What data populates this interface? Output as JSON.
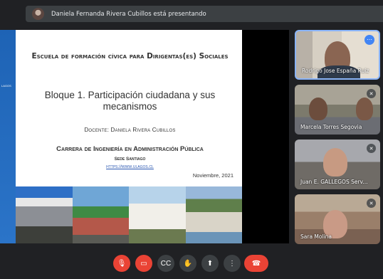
{
  "presenting": {
    "text": "Daniela Fernanda Rivera Cubillos está presentando"
  },
  "slide": {
    "sidebar_text": "LAGOS",
    "title": "Escuela de formación cívica para Dirigentas(es) Sociales",
    "subtitle": "Bloque 1. Participación ciudadana y sus mecanismos",
    "docente": "Docente: Daniela Rivera Cubillos",
    "carrera": "Carrera de Ingeniería en Administración Pública",
    "sede": "Sede Santiago",
    "url": "https://www.ulagos.cl",
    "date": "Noviembre, 2021"
  },
  "participants": [
    {
      "name": "Rodrigo Jose España Ruiz",
      "indicator": "more-icon"
    },
    {
      "name": "Marcela Torres Segovia",
      "indicator": "mic-off-icon"
    },
    {
      "name": "Juan E. GALLEGOS Serv...",
      "indicator": "mic-off-icon"
    },
    {
      "name": "Sara Molina",
      "indicator": "mic-off-icon"
    }
  ],
  "controls": {
    "mic": "mic-off-icon",
    "camera": "camera-off-icon",
    "captions": "captions-icon",
    "raise_hand": "raise-hand-icon",
    "present": "present-screen-icon",
    "more": "more-vert-icon",
    "hangup": "hangup-icon"
  },
  "colors": {
    "background": "#202124",
    "hangup": "#ea4335",
    "accent": "#4285f4"
  }
}
